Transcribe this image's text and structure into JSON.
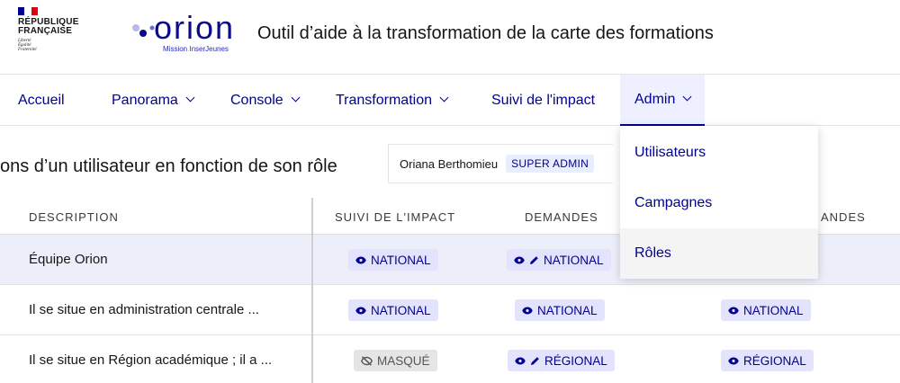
{
  "header": {
    "republic": {
      "line1": "RÉPUBLIQUE",
      "line2": "FRANÇAISE",
      "motto": [
        "Liberté",
        "Égalité",
        "Fraternité"
      ]
    },
    "brand": {
      "word": "orion",
      "subtitle": "Mission InserJeunes"
    },
    "app_title": "Outil d’aide à la transformation de la carte des formations"
  },
  "nav": {
    "items": [
      {
        "label": "Accueil",
        "has_menu": false
      },
      {
        "label": "Panorama",
        "has_menu": true
      },
      {
        "label": "Console",
        "has_menu": true
      },
      {
        "label": "Transformation",
        "has_menu": true
      },
      {
        "label": "Suivi de l'impact",
        "has_menu": false
      },
      {
        "label": "Admin",
        "has_menu": true,
        "active": true
      }
    ],
    "admin_menu": [
      "Utilisateurs",
      "Campagnes",
      "Rôles"
    ]
  },
  "page": {
    "title_visible": "ons d’un utilisateur en fonction de son rôle",
    "user": {
      "name": "Oriana Berthomieu",
      "role": "SUPER ADMIN"
    }
  },
  "table": {
    "headers": {
      "description": "DESCRIPTION",
      "suivi": "SUIVI DE L'IMPACT",
      "demandes": "DEMANDES",
      "demandes2_visible": "ANDES"
    },
    "rows": [
      {
        "description": "Équipe Orion",
        "suivi": {
          "label": "NATIONAL",
          "icons": [
            "eye-icon"
          ],
          "style": "blue"
        },
        "demandes": {
          "label": "NATIONAL",
          "icons": [
            "eye-icon",
            "pencil-icon"
          ],
          "style": "blue"
        },
        "demandes2": null
      },
      {
        "description": "Il se situe en administration centrale ...",
        "suivi": {
          "label": "NATIONAL",
          "icons": [
            "eye-icon"
          ],
          "style": "blue"
        },
        "demandes": {
          "label": "NATIONAL",
          "icons": [
            "eye-icon"
          ],
          "style": "blue"
        },
        "demandes2": {
          "label": "NATIONAL",
          "icons": [
            "eye-icon"
          ],
          "style": "blue"
        }
      },
      {
        "description": "Il se situe en Région académique ; il a ...",
        "suivi": {
          "label": "MASQUÉ",
          "icons": [
            "eye-off-icon"
          ],
          "style": "grey"
        },
        "demandes": {
          "label": "RÉGIONAL",
          "icons": [
            "eye-icon",
            "pencil-icon"
          ],
          "style": "blue"
        },
        "demandes2": {
          "label": "RÉGIONAL",
          "icons": [
            "eye-icon"
          ],
          "style": "blue"
        }
      }
    ]
  },
  "colors": {
    "primary": "#000091",
    "badge_blue_bg": "#e3e3fd",
    "badge_grey_bg": "#e5e5e5",
    "row_highlight": "#eceefa",
    "flag_blue": "#000091",
    "flag_red": "#e1000f"
  }
}
